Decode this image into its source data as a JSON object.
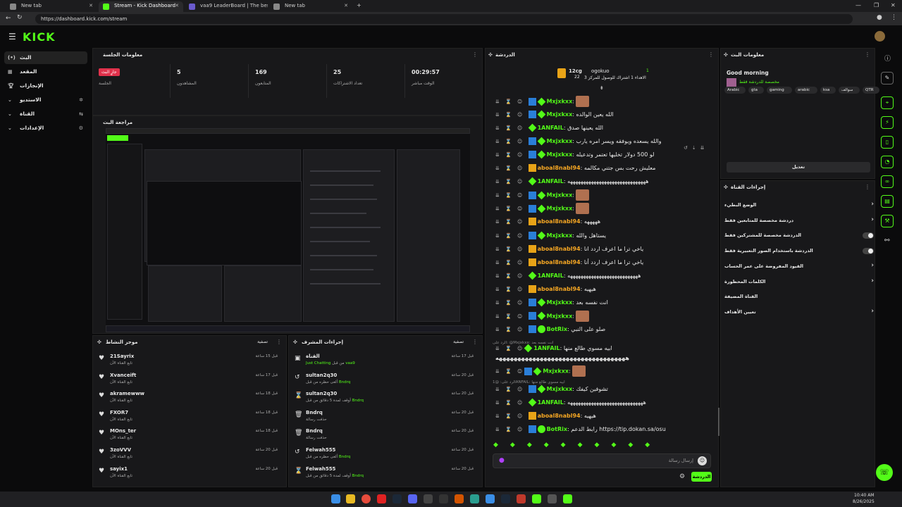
{
  "browser": {
    "tabs": [
      "New tab",
      "Stream - Kick Dashboard",
      "vaa9 LeaderBoard | The best Chat",
      "New tab"
    ],
    "url": "https://dashboard.kick.com/stream"
  },
  "header": {
    "logo": "KICK"
  },
  "sidebar": {
    "items": [
      {
        "label": "البث",
        "icon": "live-icon"
      },
      {
        "label": "المقعد",
        "icon": "dashboard-icon"
      },
      {
        "label": "الإنجازات",
        "icon": "trophy-icon"
      },
      {
        "label": "الاستديو",
        "icon": "studio-icon"
      },
      {
        "label": "القناة",
        "icon": "channel-icon"
      },
      {
        "label": "الإعدادات",
        "icon": "settings-icon"
      }
    ]
  },
  "session": {
    "title": "معلومات الجلسة",
    "live_badge": "جارٍ البث",
    "session_label": "الجلسة",
    "stats": [
      {
        "value": "5",
        "label": "المشاهدون"
      },
      {
        "value": "169",
        "label": "المتابعون"
      },
      {
        "value": "25",
        "label": "تعداد الاشتراكات"
      },
      {
        "value": "00:29:57",
        "label": "الوقت مباشر"
      }
    ]
  },
  "preview": {
    "title": "مراجعة البث"
  },
  "activity": {
    "title": "موجز النشاط",
    "filter": "تصفية",
    "rows": [
      {
        "name": "21Sayrix",
        "sub": "تابع القناة الآن",
        "time": "قبل 15 ساعة"
      },
      {
        "name": "Xvanceift",
        "sub": "تابع القناة الآن",
        "time": "قبل 17 ساعة"
      },
      {
        "name": "akramewww",
        "sub": "تابع القناة الآن",
        "time": "قبل 18 ساعة"
      },
      {
        "name": "FXOR7",
        "sub": "تابع القناة الآن",
        "time": "قبل 18 ساعة"
      },
      {
        "name": "MOns_ter",
        "sub": "تابع القناة الآن",
        "time": "قبل 18 ساعة"
      },
      {
        "name": "3zoVVV",
        "sub": "تابع القناة الآن",
        "time": "قبل 20 ساعة"
      },
      {
        "name": "sayix1",
        "sub": "تابع القناة الآن",
        "time": "قبل 20 ساعة"
      }
    ]
  },
  "moderation": {
    "title": "إجراءات المشرف",
    "filter": "تصفية",
    "rows": [
      {
        "name": "القناة",
        "pre": "Just Chatting",
        "mid": " من قبل ",
        "by": "vaa9",
        "time": "قبل 17 ساعة"
      },
      {
        "name": "sultan2q30",
        "pre": "ألغى حظره من قبل ",
        "by": "Bndrq",
        "time": "قبل 20 ساعة"
      },
      {
        "name": "sultan2q30",
        "pre": "أوقف لمدة 5 دقائق من قبل ",
        "by": "Bndrq",
        "time": "قبل 20 ساعة"
      },
      {
        "name": "Bndrq",
        "pre": "حذفت رسالة",
        "by": "",
        "time": "قبل 20 ساعة"
      },
      {
        "name": "Bndrq",
        "pre": "حذفت رسالة",
        "by": "",
        "time": "قبل 20 ساعة"
      },
      {
        "name": "Felwah555",
        "pre": "ألغى حظره من قبل ",
        "by": "Bndrq",
        "time": "قبل 20 ساعة"
      },
      {
        "name": "Felwah555",
        "pre": "أوقف لمدة 5 دقائق من قبل ",
        "by": "Bndrq",
        "time": "قبل 20 ساعة"
      }
    ]
  },
  "chat": {
    "title": "الدردشة",
    "leader_left": "12cg",
    "leader_left_count": "22",
    "leader_right": "ogokuo",
    "leader_right_count": "1",
    "leader_caption": "الاهداء 1 اشتراك للوصول للمركز 3",
    "messages": [
      {
        "user": "Mxjxkxx",
        "badge": "blue",
        "color": "green",
        "text": "",
        "emote": true
      },
      {
        "user": "Mxjxkxx",
        "badge": "blue",
        "color": "green",
        "text": "الله يعين الوالده",
        "emote": false
      },
      {
        "user": "1ANFAIL",
        "badge": "green",
        "color": "green",
        "text": "الله يعينها صدق",
        "emote": false
      },
      {
        "user": "Mxjxkxx",
        "badge": "blue",
        "color": "green",
        "text": "والله يسعده ويوفقه ويسر امره يارب",
        "emote": false
      },
      {
        "user": "Mxjxkxx",
        "badge": "blue",
        "color": "green",
        "text": "لو 500 دولار تخليها تعتمر وتدعيله",
        "emote": false
      },
      {
        "user": "aboal8nabl94",
        "badge": "gold",
        "color": "orange",
        "text": "معليش رحت بس جتني مكالمه",
        "emote": false
      },
      {
        "user": "1ANFAIL",
        "badge": "green",
        "color": "green",
        "text": "ههههههههههههههههههههههههههههههه",
        "emote": false
      },
      {
        "user": "Mxjxkxx",
        "badge": "blue",
        "color": "green",
        "text": "",
        "emote": true
      },
      {
        "user": "Mxjxkxx",
        "badge": "blue",
        "color": "green",
        "text": "",
        "emote": true
      },
      {
        "user": "aboal8nabl94",
        "badge": "gold",
        "color": "orange",
        "text": "هههههه",
        "emote": false
      },
      {
        "user": "Mxjxkxx",
        "badge": "blue",
        "color": "green",
        "text": "يستاهل والله",
        "emote": false
      },
      {
        "user": "aboal8nabl94",
        "badge": "gold",
        "color": "orange",
        "text": "ياخي ترا ما اعرف اردد انا",
        "emote": false
      },
      {
        "user": "aboal8nabl94",
        "badge": "gold",
        "color": "orange",
        "text": "ياخي ترا ما اعرف اردد أنا",
        "emote": false
      },
      {
        "user": "1ANFAIL",
        "badge": "green",
        "color": "green",
        "text": "هههههههههههههههههههههههههههه",
        "emote": false
      },
      {
        "user": "aboal8nabl94",
        "badge": "gold",
        "color": "orange",
        "text": "هيهيه",
        "emote": false
      },
      {
        "user": "Mxjxkxx",
        "badge": "blue",
        "color": "green",
        "text": "انت نفسه بعد",
        "emote": false
      },
      {
        "user": "Mxjxkxx",
        "badge": "blue",
        "color": "green",
        "text": "",
        "emote": true
      },
      {
        "user": "BotRix",
        "badge": "bot",
        "color": "green",
        "text": "صلو على النبي",
        "emote": false
      }
    ],
    "reply1": "الرد على: @Mxjxkxx: انت نفسه بعد",
    "msg_reply1_user": "1ANFAIL",
    "msg_reply1_text": "ابيه مسوي طالع منها",
    "msg_reply1_cont": "هههههههههههههههههههههههههههههههههههه",
    "msg_after_user": "Mxjxkxx",
    "reply2": "الرد على: @1ANFAIL: ابيه مسوي طالع منها",
    "tail": [
      {
        "user": "Mxjxkxx",
        "badge": "blue",
        "color": "green",
        "text": "تشوفين كيفك"
      },
      {
        "user": "1ANFAIL",
        "badge": "green",
        "color": "green",
        "text": "هههههههههههههههههههههههههههههه"
      },
      {
        "user": "aboal8nabl94",
        "badge": "gold",
        "color": "orange",
        "text": "هيهيه"
      },
      {
        "user": "BotRix",
        "badge": "bot",
        "color": "green",
        "text": "رابط الدعم https://tip.dokan.sa/osu"
      }
    ],
    "input_placeholder": "إرسال رسالة",
    "send_label": "الدردشة"
  },
  "stream_info": {
    "title": "معلومات البث",
    "stream_title": "Good morning",
    "category": "مخصصة للدردشة فقط",
    "tags": [
      "Arabic",
      "gta",
      "gaming",
      "arabic",
      "ksa",
      "سوالف",
      "QTR"
    ],
    "edit_label": "تعديل"
  },
  "channel_actions": {
    "title": "إجراءات القناة",
    "rows": [
      {
        "label": "الوضع البطيء",
        "control": "chevron"
      },
      {
        "label": "دردشة مخصصة للمتابعين فقط",
        "control": "chevron"
      },
      {
        "label": "الدردشة مخصصة للمشتركين فقط",
        "control": "toggle"
      },
      {
        "label": "الدردشة باستخدام الصور التعبيرية فقط",
        "control": "toggle"
      },
      {
        "label": "القيود المفروضة على عمر الحساب",
        "control": "chevron"
      },
      {
        "label": "الكلمات المحظورة",
        "control": "chevron"
      },
      {
        "label": "القناة المضيفة",
        "control": "none"
      },
      {
        "label": "تعيين الأهداف",
        "control": "chevron"
      }
    ]
  },
  "taskbar": {
    "time": "10:40 AM",
    "date": "8/26/2025"
  },
  "colors": {
    "accent": "#53fc18",
    "live": "#e0314b",
    "orange_user": "#f5a623"
  }
}
